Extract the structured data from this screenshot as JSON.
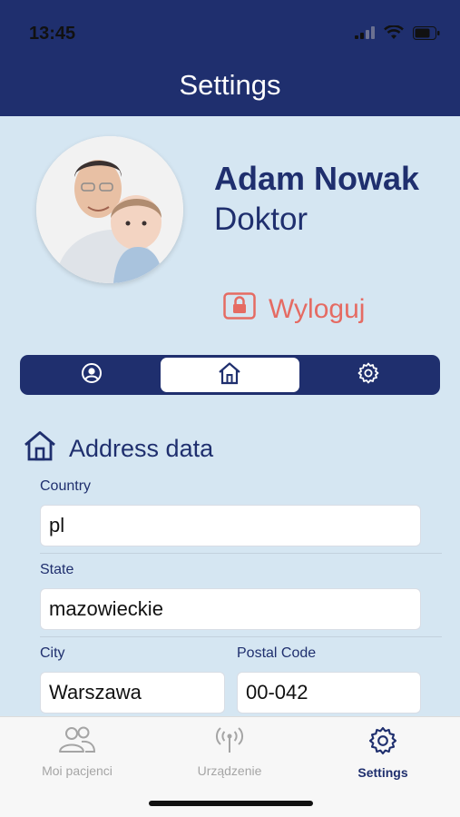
{
  "status_bar": {
    "time": "13:45"
  },
  "header": {
    "title": "Settings"
  },
  "profile": {
    "name": "Adam Nowak",
    "role": "Doktor",
    "logout_label": "Wyloguj"
  },
  "segments": [
    {
      "icon": "user-circle-icon",
      "active": false
    },
    {
      "icon": "home-icon",
      "active": true
    },
    {
      "icon": "gear-icon",
      "active": false
    }
  ],
  "address": {
    "title": "Address data",
    "country_label": "Country",
    "country_value": "pl",
    "state_label": "State",
    "state_value": "mazowieckie",
    "city_label": "City",
    "city_value": "Warszawa",
    "postal_label": "Postal Code",
    "postal_value": "00-042"
  },
  "tabbar": {
    "items": [
      {
        "label": "Moi pacjenci",
        "icon": "people-icon",
        "active": false
      },
      {
        "label": "Urządzenie",
        "icon": "antenna-icon",
        "active": false
      },
      {
        "label": "Settings",
        "icon": "gear-icon",
        "active": true
      }
    ]
  },
  "colors": {
    "primary": "#1f2f6e",
    "background": "#d5e6f2",
    "logout": "#e56b63"
  }
}
